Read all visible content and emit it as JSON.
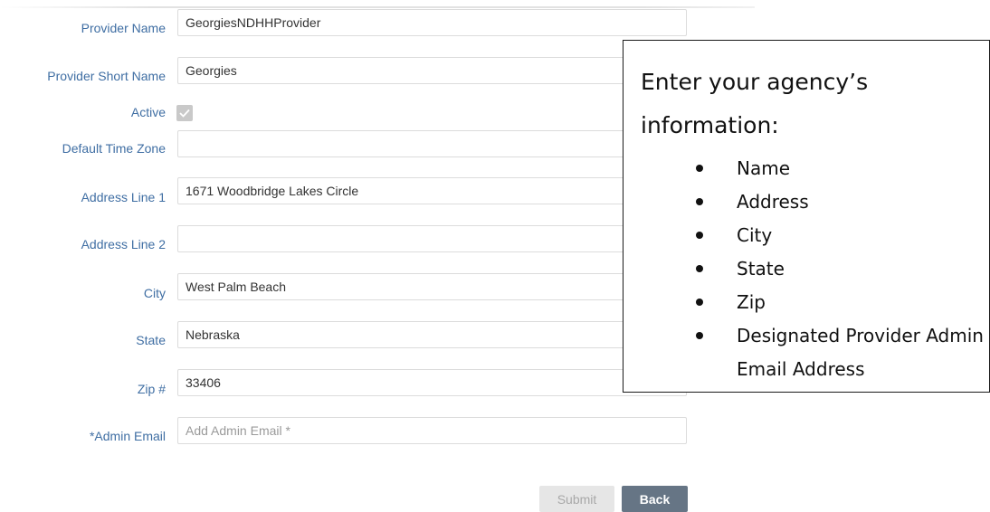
{
  "form": {
    "provider_name": {
      "label": "Provider Name",
      "value": "GeorgiesNDHHProvider"
    },
    "provider_short_name": {
      "label": "Provider Short Name",
      "value": "Georgies"
    },
    "active": {
      "label": "Active",
      "checked": true
    },
    "default_time_zone": {
      "label": "Default Time Zone",
      "value": ""
    },
    "address_line_1": {
      "label": "Address Line 1",
      "value": "1671 Woodbridge Lakes Circle"
    },
    "address_line_2": {
      "label": "Address Line 2",
      "value": ""
    },
    "city": {
      "label": "City",
      "value": "West Palm Beach"
    },
    "state": {
      "label": "State",
      "value": "Nebraska"
    },
    "zip": {
      "label": "Zip #",
      "value": "33406"
    },
    "admin_email": {
      "label": "*Admin Email",
      "value": "",
      "placeholder": "Add Admin Email *"
    }
  },
  "buttons": {
    "submit": "Submit",
    "back": "Back"
  },
  "callout": {
    "title": "Enter your agency’s information:",
    "items": [
      "Name",
      "Address",
      "City",
      "State",
      "Zip",
      "Designated Provider Admin Email Address"
    ]
  },
  "colors": {
    "label": "#3f6ea3",
    "back_button": "#667585",
    "submit_button": "#e6e6e6"
  }
}
